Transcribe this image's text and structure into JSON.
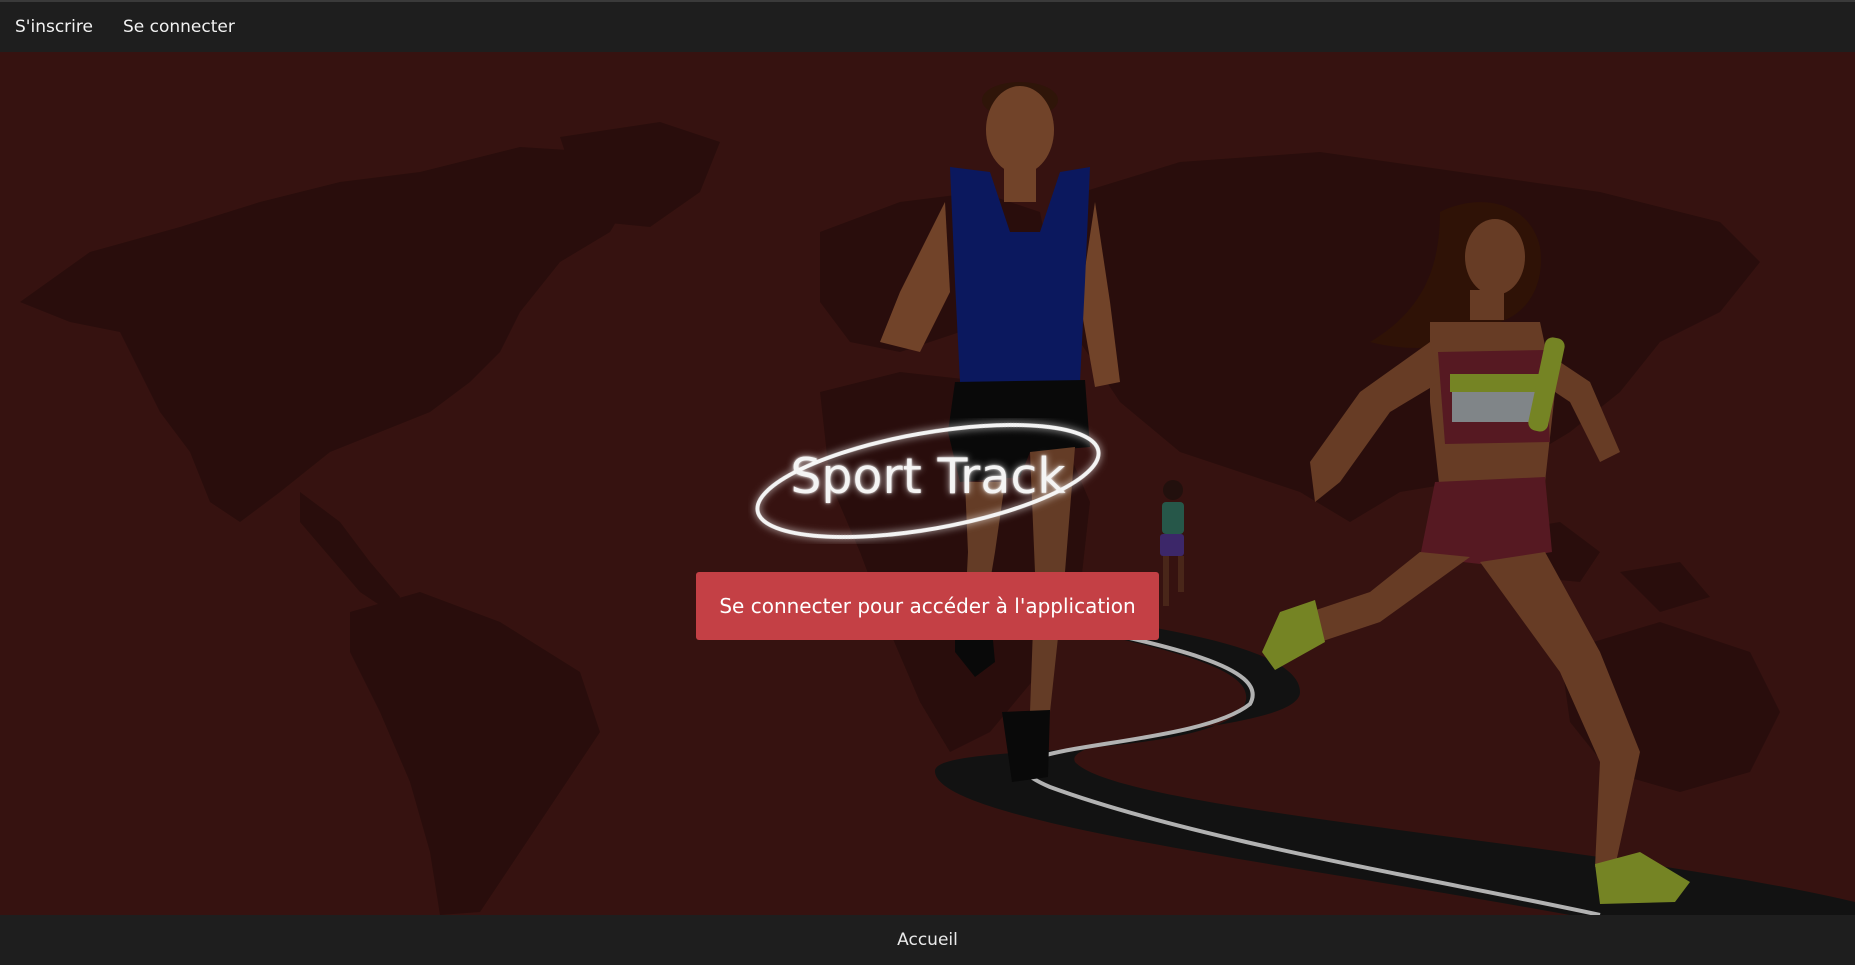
{
  "nav": {
    "register_label": "S'inscrire",
    "login_label": "Se connecter"
  },
  "hero": {
    "title": "Sport Track",
    "cta_label": "Se connecter pour accéder à l'application"
  },
  "footer": {
    "home_label": "Accueil"
  },
  "colors": {
    "background": "#421714",
    "bars": "#1e1e1e",
    "button": "#c44045",
    "text": "#f2f2f2"
  },
  "illustration": {
    "subjects": [
      "world-map",
      "male-runner",
      "female-relay-runner",
      "distant-runner",
      "road"
    ]
  }
}
